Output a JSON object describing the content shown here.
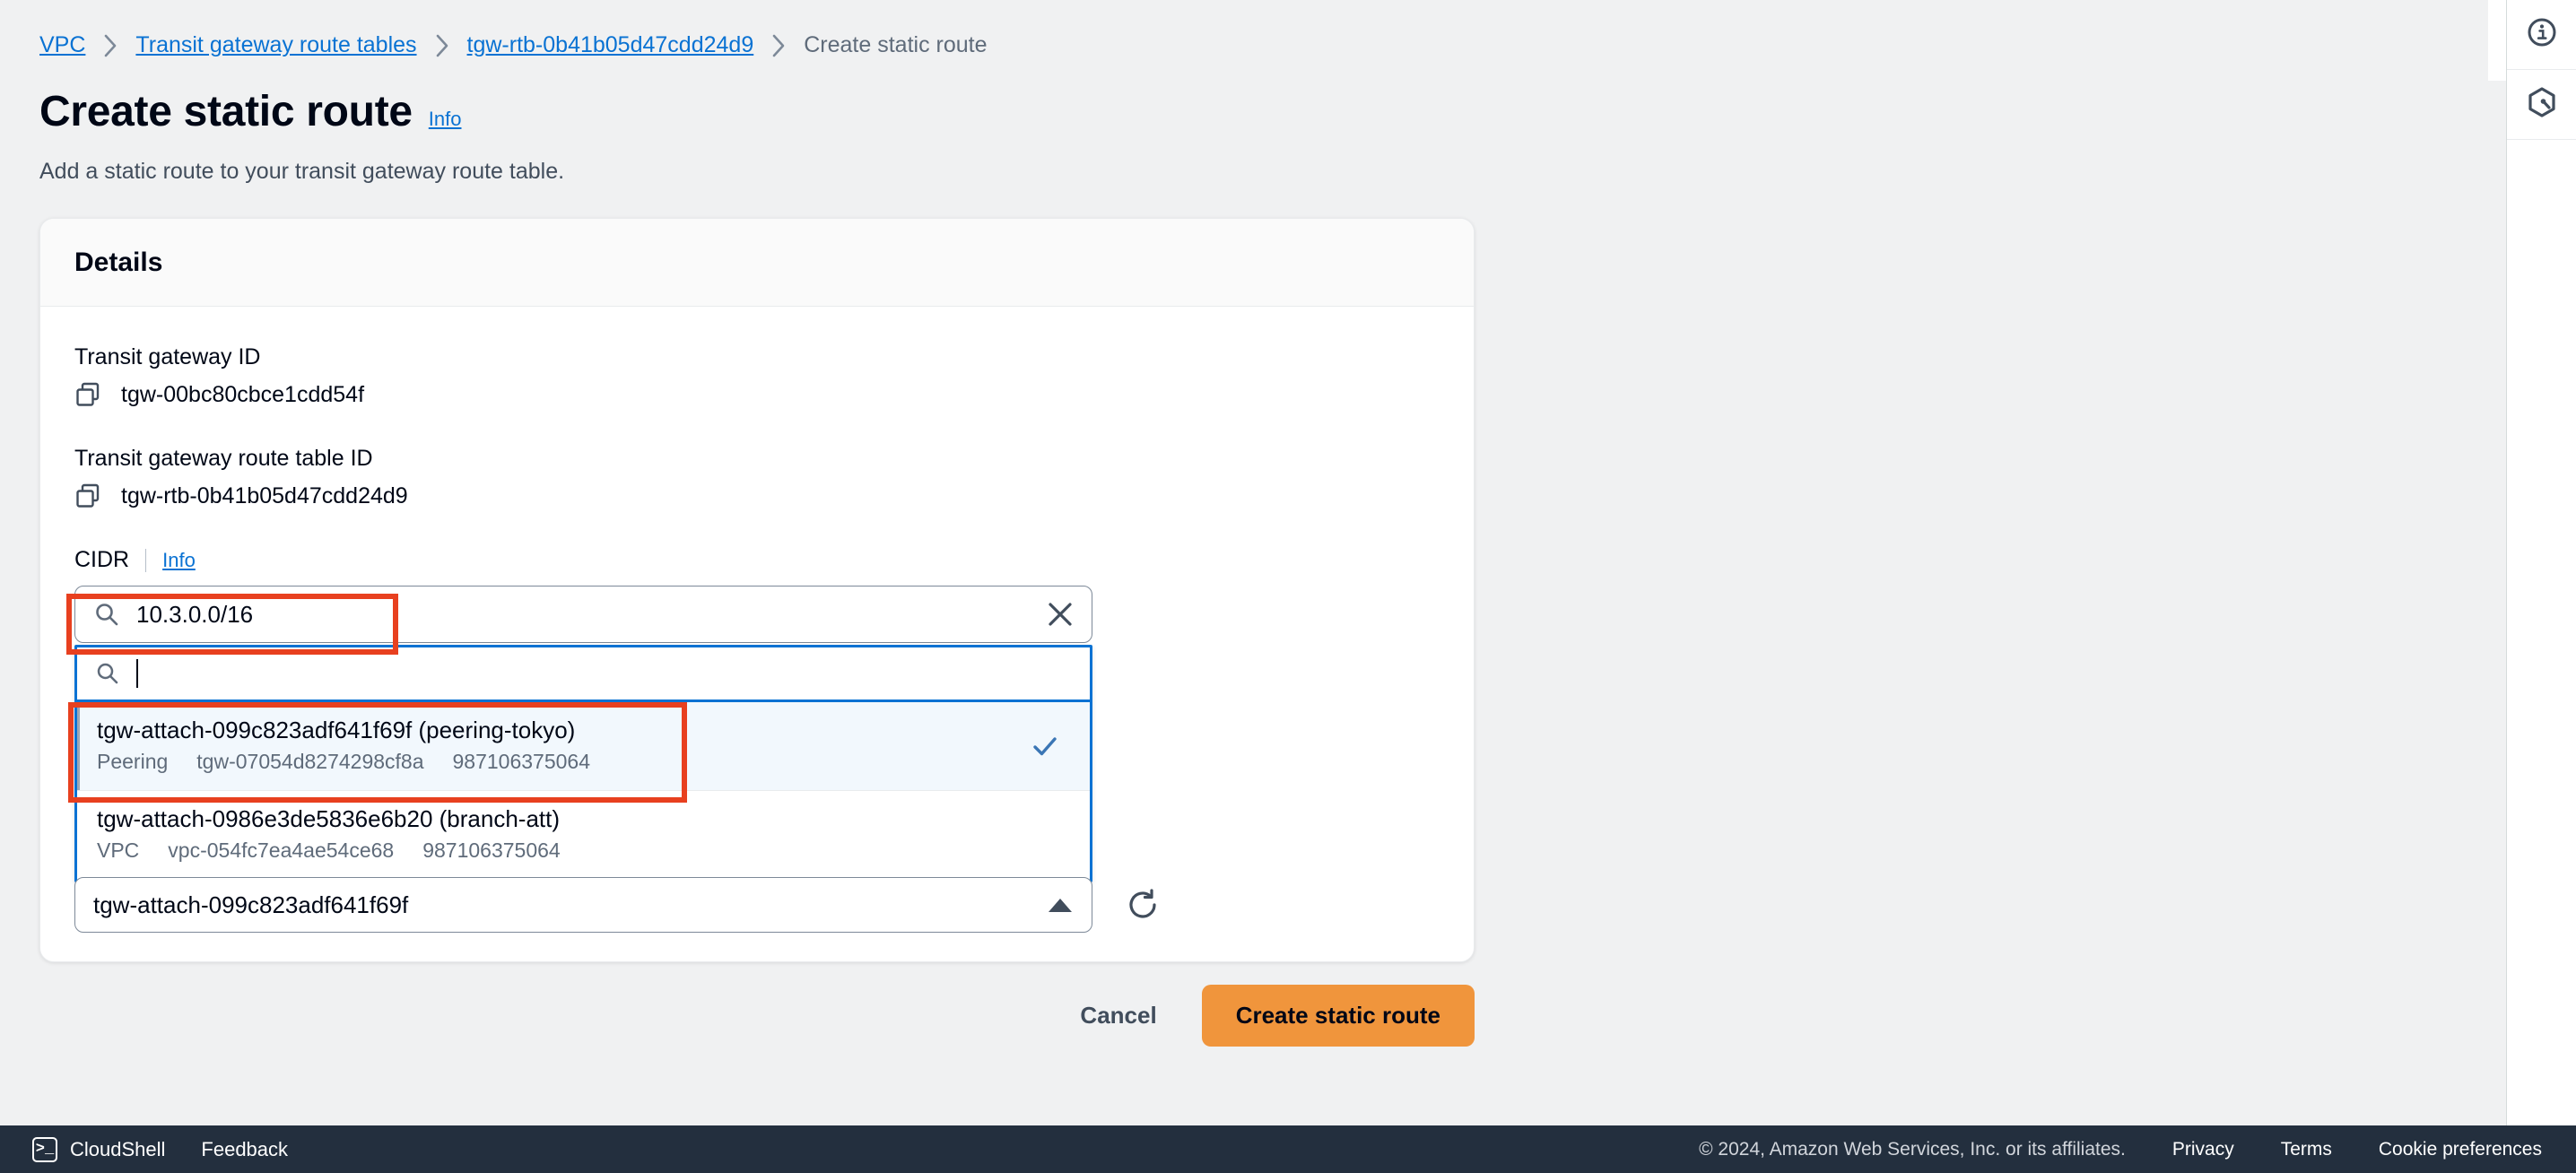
{
  "breadcrumb": {
    "items": [
      {
        "label": "VPC",
        "link": true
      },
      {
        "label": "Transit gateway route tables",
        "link": true
      },
      {
        "label": "tgw-rtb-0b41b05d47cdd24d9",
        "link": true
      },
      {
        "label": "Create static route",
        "link": false
      }
    ]
  },
  "page": {
    "title": "Create static route",
    "info_label": "Info",
    "description": "Add a static route to your transit gateway route table."
  },
  "card": {
    "header_title": "Details",
    "fields": [
      {
        "label": "Transit gateway ID",
        "value": "tgw-00bc80cbce1cdd54f",
        "copy_icon": "copy-icon"
      },
      {
        "label": "Transit gateway route table ID",
        "value": "tgw-rtb-0b41b05d47cdd24d9",
        "copy_icon": "copy-icon"
      }
    ],
    "cidr": {
      "label": "CIDR",
      "info_label": "Info",
      "value": "10.3.0.0/16",
      "placeholder": "",
      "search_icon": "search-icon",
      "clear_icon": "close-icon"
    },
    "dropdown": {
      "search_icon": "search-icon",
      "search_value": "",
      "options": [
        {
          "title": "tgw-attach-099c823adf641f69f (peering-tokyo)",
          "type": "Peering",
          "resource_id": "tgw-07054d8274298cf8a",
          "account_id": "987106375064",
          "selected": true,
          "check_icon": "check-icon"
        },
        {
          "title": "tgw-attach-0986e3de5836e6b20 (branch-att)",
          "type": "VPC",
          "resource_id": "vpc-054fc7ea4ae54ce68",
          "account_id": "987106375064",
          "selected": false,
          "check_icon": ""
        }
      ]
    },
    "attachment_select": {
      "value": "tgw-attach-099c823adf641f69f",
      "arrow_icon": "chevron-up-icon",
      "refresh_icon": "refresh-icon"
    }
  },
  "actions": {
    "cancel_label": "Cancel",
    "submit_label": "Create static route"
  },
  "right_rail": {
    "items": [
      {
        "icon": "info-circle-icon",
        "name": "info-panel-toggle"
      },
      {
        "icon": "amazon-q-hexagon-icon",
        "name": "amazon-q-toggle"
      }
    ]
  },
  "footer": {
    "cloudshell_label": "CloudShell",
    "cloudshell_icon": "cloudshell-icon",
    "feedback_label": "Feedback",
    "copyright": "© 2024, Amazon Web Services, Inc. or its affiliates.",
    "links": [
      {
        "label": "Privacy"
      },
      {
        "label": "Terms"
      },
      {
        "label": "Cookie preferences"
      }
    ]
  },
  "annotations": {
    "accent_color": "#e8401f",
    "boxes": [
      {
        "name": "cidr-input-highlight"
      },
      {
        "name": "selected-option-highlight"
      }
    ]
  },
  "colors": {
    "primary_button": "#f0953c",
    "link": "#0972d3",
    "footer_bg": "#232f3e",
    "page_bg": "#f0f1f2"
  }
}
